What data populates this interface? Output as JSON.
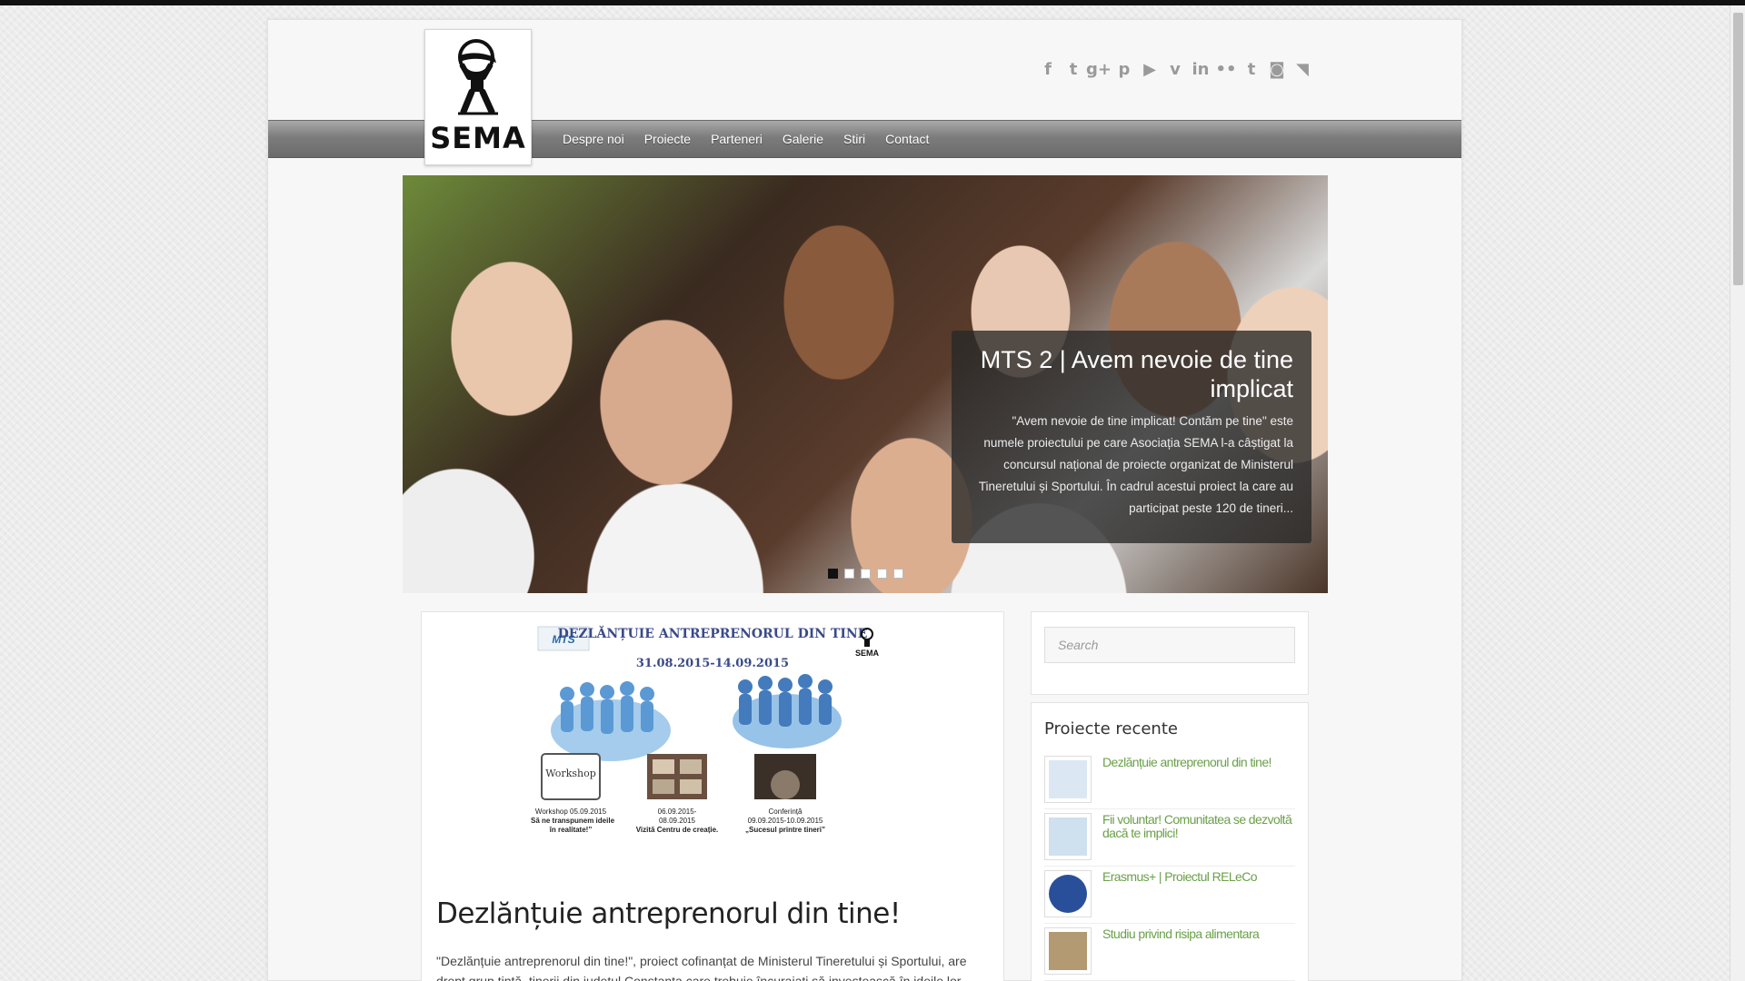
{
  "brand": {
    "logo_text": "SEMA"
  },
  "nav": {
    "items": [
      "Despre noi",
      "Proiecte",
      "Parteneri",
      "Galerie",
      "Stiri",
      "Contact"
    ]
  },
  "social": [
    {
      "name": "facebook-icon",
      "glyph": "f"
    },
    {
      "name": "twitter-icon",
      "glyph": "t"
    },
    {
      "name": "google-plus-icon",
      "glyph": "g+"
    },
    {
      "name": "pinterest-icon",
      "glyph": "p"
    },
    {
      "name": "youtube-icon",
      "glyph": "▶"
    },
    {
      "name": "vimeo-icon",
      "glyph": "v"
    },
    {
      "name": "linkedin-icon",
      "glyph": "in"
    },
    {
      "name": "flickr-icon",
      "glyph": "••"
    },
    {
      "name": "tumblr-icon",
      "glyph": "t"
    },
    {
      "name": "instagram-icon",
      "glyph": "◙"
    },
    {
      "name": "rss-icon",
      "glyph": "◥"
    }
  ],
  "slider": {
    "title": "MTS 2 | Avem nevoie de tine implicat",
    "text": "\"Avem nevoie de tine implicat! Contăm pe tine\" este numele proiectului pe care Asociația SEMA l-a câștigat la concursul național de proiecte organizat de Ministerul Tineretului și Sportului. În cadrul acestui proiect la care au participat peste 120 de tineri...",
    "dots": 5,
    "active_dot": 0
  },
  "post": {
    "poster": {
      "heading": "DEZLĂNȚUIE ANTREPRENORUL DIN TINE",
      "dates": "31.08.2015-14.09.2015",
      "partner_logo": "MTS",
      "sema_logo": "SEMA",
      "workshop_label": "Workshop",
      "items": [
        {
          "line1": "Workshop 05.09.2015",
          "line2": "„Să ne transpunem ideile",
          "line3": "în realitate!”"
        },
        {
          "line1": "06.09.2015-",
          "line2": "08.09.2015",
          "line3": "Vizită Centru de creație."
        },
        {
          "line1": "Conferință",
          "line2": "09.09.2015-10.09.2015",
          "line3": "„Sucesul printre tineri”"
        }
      ]
    },
    "title": "Dezlănțuie antreprenorul din tine!",
    "excerpt": "\"Dezlănțuie antreprenorul din tine!\", proiect cofinanțat de Ministerul Tineretului și Sportului, are drept grup țintă, tinerii din județul Constanța care trebuie încurajați să investească în ideile lor."
  },
  "sidebar": {
    "search_placeholder": "Search",
    "recent_title": "Proiecte recente",
    "recent": [
      "Dezlănțuie antreprenorul din tine!",
      "Fii voluntar! Comunitatea se dezvoltă dacă te implici!",
      "Erasmus+ | Proiectul RELeCo",
      "Studiu privind risipa alimentara"
    ]
  },
  "colors": {
    "link_green": "#6aa04a",
    "nav_gradient_top": "#a9a9a9",
    "nav_gradient_bottom": "#6b6b6b"
  }
}
